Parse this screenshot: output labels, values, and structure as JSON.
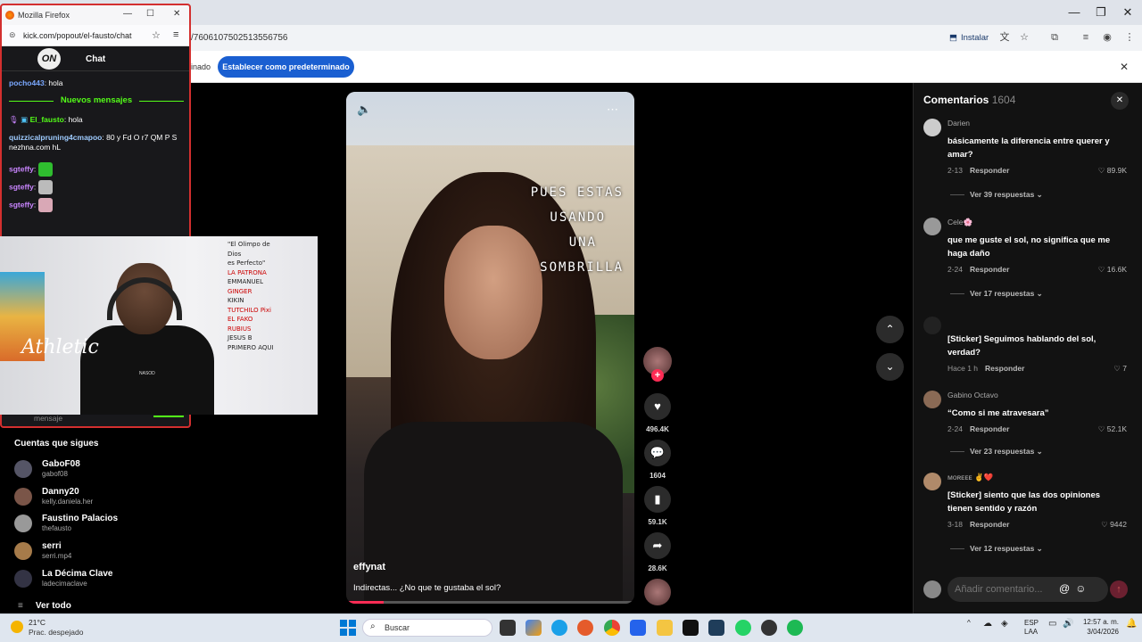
{
  "browser": {
    "url": "/7606107502513556756",
    "install_label": "Instalar",
    "banner_text": "inado",
    "banner_button": "Establecer como predeterminado"
  },
  "popout": {
    "window_title": "Mozilla Firefox",
    "url": "kick.com/popout/el-fausto/chat",
    "logo_text": "ON",
    "chat_label": "Chat",
    "new_messages": "Nuevos mensajes",
    "messages": [
      {
        "user": "pocho443",
        "text": ": hola",
        "color": "#7aa8ff"
      },
      {
        "user": "El_fausto",
        "text": ": hola",
        "color": "#53fc18"
      },
      {
        "user": "quizzicalpruning4cmapoo",
        "text": ": 80 y Fd O r7 QM P S nezhna.com hL",
        "color": "#9ecbff"
      },
      {
        "user": "sgteffy",
        "text": ":",
        "color": "#c985ff"
      },
      {
        "user": "sgteffy",
        "text": ":",
        "color": "#c985ff"
      },
      {
        "user": "sgteffy",
        "text": ":",
        "color": "#c985ff"
      }
    ],
    "input_placeholder": "mensaje"
  },
  "webcam": {
    "shirt_text": "Athletic",
    "shirt_subtext": "NASOD",
    "wall_list": [
      "\"El Olimpo de",
      "Dios",
      "es Perfecto\"",
      "LA PATRONA",
      "EMMANUEL",
      "GINGER",
      "KIKIN",
      "TUTCHILO Pixi",
      "EL FAKO",
      "RUBIUS",
      "JESUS B",
      "PRIMERO AQUI"
    ]
  },
  "following": {
    "title": "Cuentas que sigues",
    "accounts": [
      {
        "name": "GaboF08",
        "handle": "gabof08"
      },
      {
        "name": "Danny20",
        "handle": "kelly.daniela.her"
      },
      {
        "name": "Faustino Palacios",
        "handle": "thefausto"
      },
      {
        "name": "serri",
        "handle": "serri.mp4"
      },
      {
        "name": "La Décima Clave",
        "handle": "ladecimaclave"
      }
    ],
    "see_all": "Ver todo"
  },
  "video": {
    "overlay_lines": [
      "PUES ESTAS",
      "USANDO",
      "UNA",
      "SOMBRILLA"
    ],
    "author": "effynat",
    "description": "Indirectas... ¿No que te gustaba el sol?",
    "progress": 0.13
  },
  "actions": {
    "likes": "496.4K",
    "comments": "1604",
    "saves": "59.1K",
    "shares": "28.6K"
  },
  "comments": {
    "title": "Comentarios",
    "count": "1604",
    "items": [
      {
        "user": "Darien",
        "text": "básicamente la diferencia entre querer y amar?",
        "date": "2-13",
        "reply": "Responder",
        "likes": "89.9K",
        "more": "Ver 39 respuestas"
      },
      {
        "user": "Cele🌸",
        "text": "que me guste el sol, no significa que me haga daño",
        "date": "2-24",
        "reply": "Responder",
        "likes": "16.6K",
        "more": "Ver 17 respuestas"
      },
      {
        "user": "",
        "text": "[Sticker] Seguimos hablando del sol, verdad?",
        "date": "Hace 1 h",
        "reply": "Responder",
        "likes": "7",
        "more": ""
      },
      {
        "user": "Gabino Octavo",
        "text": "“Como si me atravesara”",
        "date": "2-24",
        "reply": "Responder",
        "likes": "52.1K",
        "more": "Ver 23 respuestas"
      },
      {
        "user": "ᴍᴏʀᴇᴇᴇ ✌️❤️",
        "text": "[Sticker] siento que las dos opiniones tienen sentido y razón",
        "date": "3-18",
        "reply": "Responder",
        "likes": "9442",
        "more": "Ver 12 respuestas"
      }
    ],
    "input_placeholder": "Añadir comentario..."
  },
  "taskbar": {
    "temp": "21°C",
    "weather": "Prac. despejado",
    "search": "Buscar",
    "lang": "ESP",
    "lang2": "LAA",
    "time": "12:57 a. m.",
    "date": "3/04/2026"
  }
}
